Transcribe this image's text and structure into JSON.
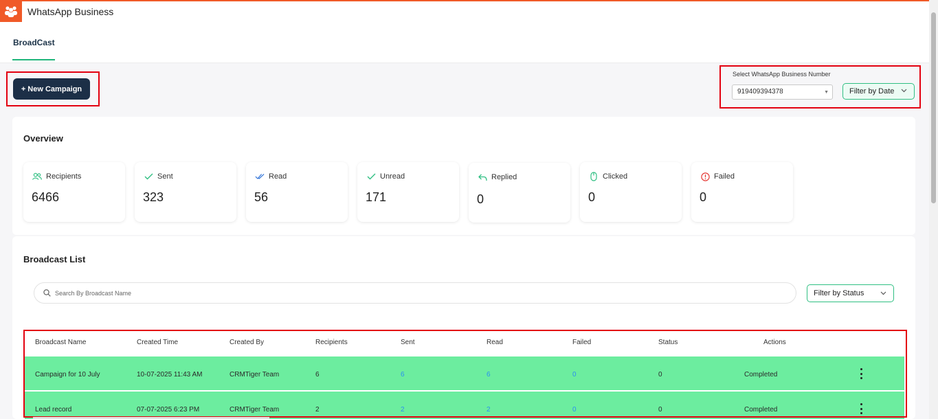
{
  "app": {
    "title": "WhatsApp Business",
    "logo_icon": "people-group-icon",
    "accent": "#f05a28"
  },
  "tabs": [
    {
      "label": "BroadCast",
      "active": true
    }
  ],
  "toolbar": {
    "new_campaign_label": "+ New Campaign",
    "number_select_label": "Select WhatsApp Business Number",
    "number_selected": "919409394378",
    "date_filter_label": "Filter by Date"
  },
  "overview": {
    "title": "Overview",
    "stats": [
      {
        "label": "Recipients",
        "value": "6466",
        "icon": "users-icon"
      },
      {
        "label": "Sent",
        "value": "323",
        "icon": "check-icon"
      },
      {
        "label": "Read",
        "value": "56",
        "icon": "double-check-icon"
      },
      {
        "label": "Unread",
        "value": "171",
        "icon": "check-icon"
      },
      {
        "label": "Replied",
        "value": "0",
        "icon": "reply-icon"
      },
      {
        "label": "Clicked",
        "value": "0",
        "icon": "mouse-icon"
      },
      {
        "label": "Failed",
        "value": "0",
        "icon": "alert-circle-icon"
      }
    ]
  },
  "broadcast_list": {
    "title": "Broadcast List",
    "search_placeholder": "Search By Broadcast Name",
    "status_filter_label": "Filter by Status",
    "columns": [
      "Broadcast Name",
      "Created Time",
      "Created By",
      "Recipients",
      "Sent",
      "Read",
      "Failed",
      "Status",
      "Actions"
    ],
    "rows": [
      {
        "name": "Campaign for 10 July",
        "created_time": "10-07-2025 11:43 AM",
        "created_by": "CRMTiger Team",
        "recipients": "6",
        "sent": "6",
        "read": "6",
        "failed": "0",
        "status_count": "0",
        "status": "Completed"
      },
      {
        "name": "Lead record",
        "created_time": "07-07-2025 6:23 PM",
        "created_by": "CRMTiger Team",
        "recipients": "2",
        "sent": "2",
        "read": "2",
        "failed": "0",
        "status_count": "0",
        "status": "Completed"
      }
    ]
  },
  "colors": {
    "primary_button": "#1c2f47",
    "green_accent": "#2fbf82",
    "row_highlight": "#6ced9f",
    "link": "#2b8ff0",
    "annotation": "#e3000f"
  }
}
